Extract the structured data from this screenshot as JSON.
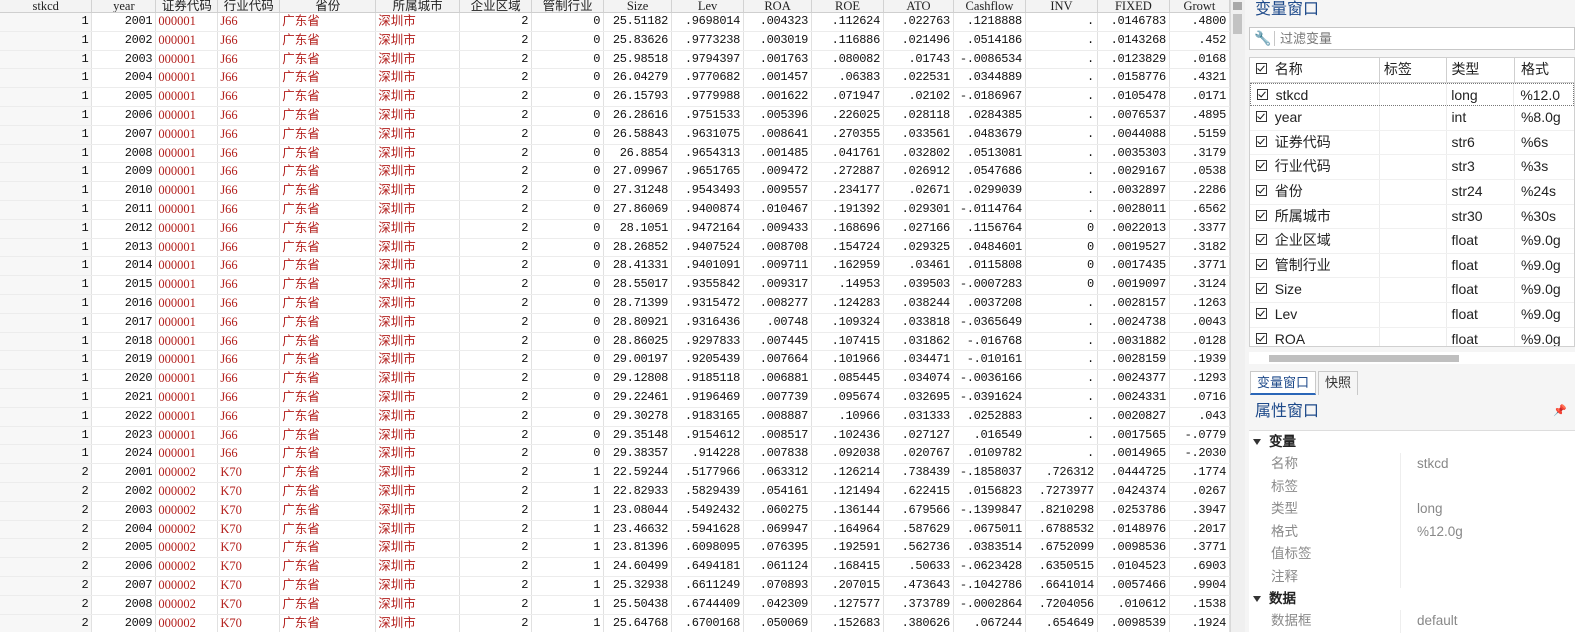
{
  "grid": {
    "columns": [
      "stkcd",
      "year",
      "证券代码",
      "行业代码",
      "省份",
      "所属城市",
      "企业区域",
      "管制行业",
      "Size",
      "Lev",
      "ROA",
      "ROE",
      "ATO",
      "Cashflow",
      "INV",
      "FIXED",
      "Growt"
    ],
    "rows": [
      [
        "1",
        "2001",
        "000001",
        "J66",
        "广东省",
        "深圳市",
        "2",
        "0",
        "25.51182",
        ".9698014",
        ".004323",
        ".112624",
        ".022763",
        ".1218888",
        ".",
        ".0146783",
        ".4800"
      ],
      [
        "1",
        "2002",
        "000001",
        "J66",
        "广东省",
        "深圳市",
        "2",
        "0",
        "25.83626",
        ".9773238",
        ".003019",
        ".116886",
        ".021496",
        ".0514186",
        ".",
        ".0143268",
        ".452"
      ],
      [
        "1",
        "2003",
        "000001",
        "J66",
        "广东省",
        "深圳市",
        "2",
        "0",
        "25.98518",
        ".9794397",
        ".001763",
        ".080082",
        ".01743",
        "-.0086534",
        ".",
        ".0123829",
        ".0168"
      ],
      [
        "1",
        "2004",
        "000001",
        "J66",
        "广东省",
        "深圳市",
        "2",
        "0",
        "26.04279",
        ".9770682",
        ".001457",
        ".06383",
        ".022531",
        ".0344889",
        ".",
        ".0158776",
        ".4321"
      ],
      [
        "1",
        "2005",
        "000001",
        "J66",
        "广东省",
        "深圳市",
        "2",
        "0",
        "26.15793",
        ".9779988",
        ".001622",
        ".071947",
        ".02102",
        "-.0186967",
        ".",
        ".0105478",
        ".0171"
      ],
      [
        "1",
        "2006",
        "000001",
        "J66",
        "广东省",
        "深圳市",
        "2",
        "0",
        "26.28616",
        ".9751533",
        ".005396",
        ".226025",
        ".028118",
        ".0284385",
        ".",
        ".0076537",
        ".4895"
      ],
      [
        "1",
        "2007",
        "000001",
        "J66",
        "广东省",
        "深圳市",
        "2",
        "0",
        "26.58843",
        ".9631075",
        ".008641",
        ".270355",
        ".033561",
        ".0483679",
        ".",
        ".0044088",
        ".5159"
      ],
      [
        "1",
        "2008",
        "000001",
        "J66",
        "广东省",
        "深圳市",
        "2",
        "0",
        "26.8854",
        ".9654313",
        ".001485",
        ".041761",
        ".032802",
        ".0513081",
        ".",
        ".0035303",
        ".3179"
      ],
      [
        "1",
        "2009",
        "000001",
        "J66",
        "广东省",
        "深圳市",
        "2",
        "0",
        "27.09967",
        ".9651765",
        ".009472",
        ".272887",
        ".026912",
        ".0547686",
        ".",
        ".0029167",
        ".0538"
      ],
      [
        "1",
        "2010",
        "000001",
        "J66",
        "广东省",
        "深圳市",
        "2",
        "0",
        "27.31248",
        ".9543493",
        ".009557",
        ".234177",
        ".02671",
        ".0299039",
        ".",
        ".0032897",
        ".2286"
      ],
      [
        "1",
        "2011",
        "000001",
        "J66",
        "广东省",
        "深圳市",
        "2",
        "0",
        "27.86069",
        ".9400874",
        ".010467",
        ".191392",
        ".029301",
        "-.0114764",
        ".",
        ".0028011",
        ".6562"
      ],
      [
        "1",
        "2012",
        "000001",
        "J66",
        "广东省",
        "深圳市",
        "2",
        "0",
        "28.1051",
        ".9472164",
        ".009433",
        ".168696",
        ".027166",
        ".1156764",
        "0",
        ".0022013",
        ".3377"
      ],
      [
        "1",
        "2013",
        "000001",
        "J66",
        "广东省",
        "深圳市",
        "2",
        "0",
        "28.26852",
        ".9407524",
        ".008708",
        ".154724",
        ".029325",
        ".0484601",
        "0",
        ".0019527",
        ".3182"
      ],
      [
        "1",
        "2014",
        "000001",
        "J66",
        "广东省",
        "深圳市",
        "2",
        "0",
        "28.41331",
        ".9401091",
        ".009711",
        ".162959",
        ".03461",
        ".0115808",
        "0",
        ".0017435",
        ".3771"
      ],
      [
        "1",
        "2015",
        "000001",
        "J66",
        "广东省",
        "深圳市",
        "2",
        "0",
        "28.55017",
        ".9355842",
        ".009317",
        ".14953",
        ".039503",
        "-.0007283",
        "0",
        ".0019097",
        ".3124"
      ],
      [
        "1",
        "2016",
        "000001",
        "J66",
        "广东省",
        "深圳市",
        "2",
        "0",
        "28.71399",
        ".9315472",
        ".008277",
        ".124283",
        ".038244",
        ".0037208",
        ".",
        ".0028157",
        ".1263"
      ],
      [
        "1",
        "2017",
        "000001",
        "J66",
        "广东省",
        "深圳市",
        "2",
        "0",
        "28.80921",
        ".9316436",
        ".00748",
        ".109324",
        ".033818",
        "-.0365649",
        ".",
        ".0024738",
        ".0043"
      ],
      [
        "1",
        "2018",
        "000001",
        "J66",
        "广东省",
        "深圳市",
        "2",
        "0",
        "28.86025",
        ".9297833",
        ".007445",
        ".107415",
        ".031862",
        "-.016768",
        ".",
        ".0031882",
        ".0128"
      ],
      [
        "1",
        "2019",
        "000001",
        "J66",
        "广东省",
        "深圳市",
        "2",
        "0",
        "29.00197",
        ".9205439",
        ".007664",
        ".101966",
        ".034471",
        "-.010161",
        ".",
        ".0028159",
        ".1939"
      ],
      [
        "1",
        "2020",
        "000001",
        "J66",
        "广东省",
        "深圳市",
        "2",
        "0",
        "29.12808",
        ".9185118",
        ".006881",
        ".085445",
        ".034074",
        "-.0036166",
        ".",
        ".0024377",
        ".1293"
      ],
      [
        "1",
        "2021",
        "000001",
        "J66",
        "广东省",
        "深圳市",
        "2",
        "0",
        "29.22461",
        ".9196469",
        ".007739",
        ".095674",
        ".032695",
        "-.0391624",
        ".",
        ".0024331",
        ".0716"
      ],
      [
        "1",
        "2022",
        "000001",
        "J66",
        "广东省",
        "深圳市",
        "2",
        "0",
        "29.30278",
        ".9183165",
        ".008887",
        ".10966",
        ".031333",
        ".0252883",
        ".",
        ".0020827",
        ".043"
      ],
      [
        "1",
        "2023",
        "000001",
        "J66",
        "广东省",
        "深圳市",
        "2",
        "0",
        "29.35148",
        ".9154612",
        ".008517",
        ".102436",
        ".027127",
        ".016549",
        ".",
        ".0017565",
        "-.0779"
      ],
      [
        "1",
        "2024",
        "000001",
        "J66",
        "广东省",
        "深圳市",
        "2",
        "0",
        "29.38357",
        ".914228",
        ".007838",
        ".092038",
        ".020767",
        ".0109782",
        ".",
        ".0014965",
        "-.2030"
      ],
      [
        "2",
        "2001",
        "000002",
        "K70",
        "广东省",
        "深圳市",
        "2",
        "1",
        "22.59244",
        ".5177966",
        ".063312",
        ".126214",
        ".738439",
        "-.1858037",
        ".726312",
        ".0444725",
        ".1774"
      ],
      [
        "2",
        "2002",
        "000002",
        "K70",
        "广东省",
        "深圳市",
        "2",
        "1",
        "22.82933",
        ".5829439",
        ".054161",
        ".121494",
        ".622415",
        ".0156823",
        ".7273977",
        ".0424374",
        ".0267"
      ],
      [
        "2",
        "2003",
        "000002",
        "K70",
        "广东省",
        "深圳市",
        "2",
        "1",
        "23.08044",
        ".5492432",
        ".060275",
        ".136144",
        ".679566",
        "-.1399847",
        ".8210298",
        ".0253786",
        ".3947"
      ],
      [
        "2",
        "2004",
        "000002",
        "K70",
        "广东省",
        "深圳市",
        "2",
        "1",
        "23.46632",
        ".5941628",
        ".069947",
        ".164964",
        ".587629",
        ".0675011",
        ".6788532",
        ".0148976",
        ".2017"
      ],
      [
        "2",
        "2005",
        "000002",
        "K70",
        "广东省",
        "深圳市",
        "2",
        "1",
        "23.81396",
        ".6098095",
        ".076395",
        ".192591",
        ".562736",
        ".0383514",
        ".6752099",
        ".0098536",
        ".3771"
      ],
      [
        "2",
        "2006",
        "000002",
        "K70",
        "广东省",
        "深圳市",
        "2",
        "1",
        "24.60499",
        ".6494181",
        ".061124",
        ".168415",
        ".50633",
        "-.0623428",
        ".6350515",
        ".0104523",
        ".6903"
      ],
      [
        "2",
        "2007",
        "000002",
        "K70",
        "广东省",
        "深圳市",
        "2",
        "1",
        "25.32938",
        ".6611249",
        ".070893",
        ".207015",
        ".473643",
        "-.1042786",
        ".6641014",
        ".0057466",
        ".9904"
      ],
      [
        "2",
        "2008",
        "000002",
        "K70",
        "广东省",
        "深圳市",
        "2",
        "1",
        "25.50438",
        ".6744409",
        ".042309",
        ".127577",
        ".373789",
        "-.0002864",
        ".7204056",
        ".010612",
        ".1538"
      ],
      [
        "2",
        "2009",
        "000002",
        "K70",
        "广东省",
        "深圳市",
        "2",
        "1",
        "25.64768",
        ".6700168",
        ".050069",
        ".152683",
        ".380626",
        ".067244",
        ".654649",
        ".0098539",
        ".1924"
      ],
      [
        "2",
        "2010",
        "000002",
        "K70",
        "广东省",
        "深圳市",
        "2",
        "1",
        "26.09686",
        ".7468613",
        ".050048",
        ".176802",
        ".28713",
        ".0103751",
        ".6183221",
        ".0056557",
        ".0374"
      ]
    ]
  },
  "var_window": {
    "title": "变量窗口",
    "filter_placeholder": "过滤变量",
    "headers": {
      "name": "名称",
      "label": "标签",
      "type": "类型",
      "format": "格式"
    },
    "vars": [
      {
        "name": "stkcd",
        "label": "",
        "type": "long",
        "format": "%12.0"
      },
      {
        "name": "year",
        "label": "",
        "type": "int",
        "format": "%8.0g"
      },
      {
        "name": "证券代码",
        "label": "",
        "type": "str6",
        "format": "%6s"
      },
      {
        "name": "行业代码",
        "label": "",
        "type": "str3",
        "format": "%3s"
      },
      {
        "name": "省份",
        "label": "",
        "type": "str24",
        "format": "%24s"
      },
      {
        "name": "所属城市",
        "label": "",
        "type": "str30",
        "format": "%30s"
      },
      {
        "name": "企业区域",
        "label": "",
        "type": "float",
        "format": "%9.0g"
      },
      {
        "name": "管制行业",
        "label": "",
        "type": "float",
        "format": "%9.0g"
      },
      {
        "name": "Size",
        "label": "",
        "type": "float",
        "format": "%9.0g"
      },
      {
        "name": "Lev",
        "label": "",
        "type": "float",
        "format": "%9.0g"
      },
      {
        "name": "ROA",
        "label": "",
        "type": "float",
        "format": "%9.0g"
      }
    ]
  },
  "tabs": {
    "var_window": "变量窗口",
    "snapshot": "快照"
  },
  "prop_window": {
    "title": "属性窗口",
    "sections": [
      {
        "title": "变量",
        "rows": [
          {
            "key": "名称",
            "value": "stkcd"
          },
          {
            "key": "标签",
            "value": ""
          },
          {
            "key": "类型",
            "value": "long"
          },
          {
            "key": "格式",
            "value": "%12.0g"
          },
          {
            "key": "值标签",
            "value": ""
          },
          {
            "key": "注释",
            "value": ""
          }
        ]
      },
      {
        "title": "数据",
        "rows": [
          {
            "key": "数据框",
            "value": "default"
          }
        ]
      }
    ]
  }
}
